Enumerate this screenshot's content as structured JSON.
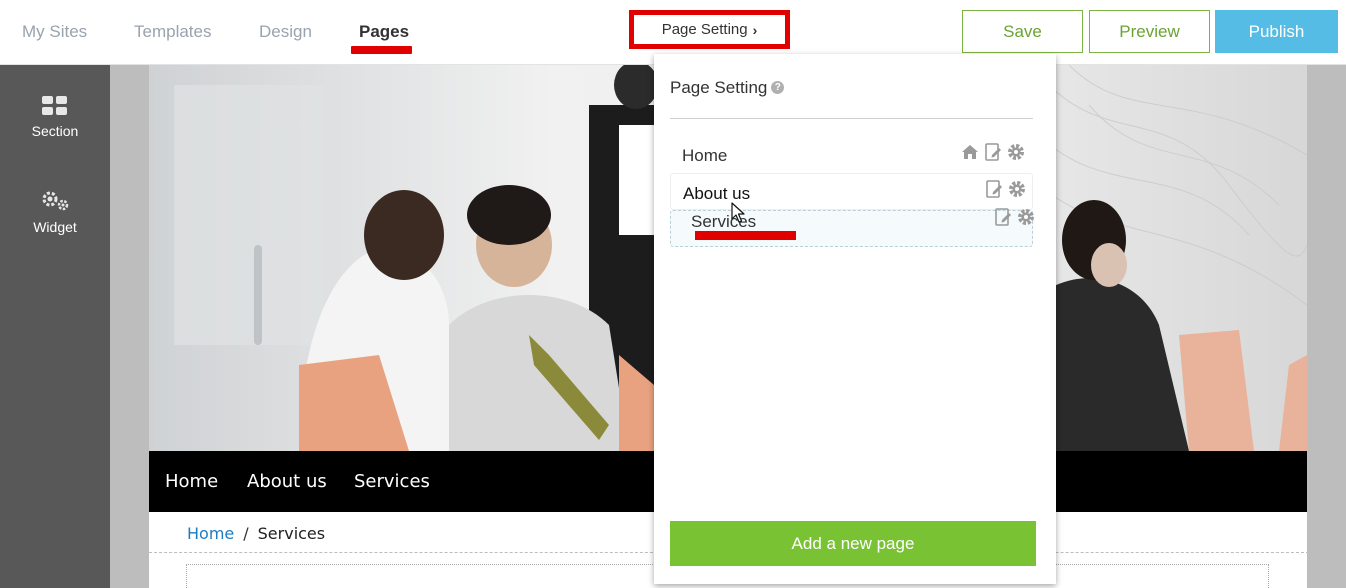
{
  "topnav": {
    "tabs": [
      {
        "label": "My Sites"
      },
      {
        "label": "Templates"
      },
      {
        "label": "Design"
      },
      {
        "label": "Pages"
      }
    ],
    "active_tab": "Pages",
    "page_setting_label": "Page Setting",
    "save_label": "Save",
    "preview_label": "Preview",
    "publish_label": "Publish"
  },
  "sidebar": {
    "items": [
      {
        "label": "Section",
        "icon": "grid-icon"
      },
      {
        "label": "Widget",
        "icon": "gears-icon"
      }
    ]
  },
  "site": {
    "nav": [
      {
        "label": "Home"
      },
      {
        "label": "About us"
      },
      {
        "label": "Services"
      }
    ],
    "breadcrumb": {
      "home": "Home",
      "separator": "/",
      "current": "Services"
    }
  },
  "panel": {
    "title": "Page Setting",
    "pages": [
      {
        "label": "Home",
        "icons": [
          "home-icon",
          "edit-page-icon",
          "gear-icon"
        ]
      },
      {
        "label": "About us",
        "icons": [
          "edit-page-icon",
          "gear-icon"
        ]
      },
      {
        "label": "Services",
        "icons": [
          "edit-page-icon",
          "gear-icon"
        ],
        "state": "dragging"
      }
    ],
    "add_page_label": "Add a new page"
  },
  "colors": {
    "accent_green": "#79c234",
    "publish_blue": "#55bde5",
    "highlight_red": "#e00000",
    "sidebar_gray": "#585858"
  }
}
